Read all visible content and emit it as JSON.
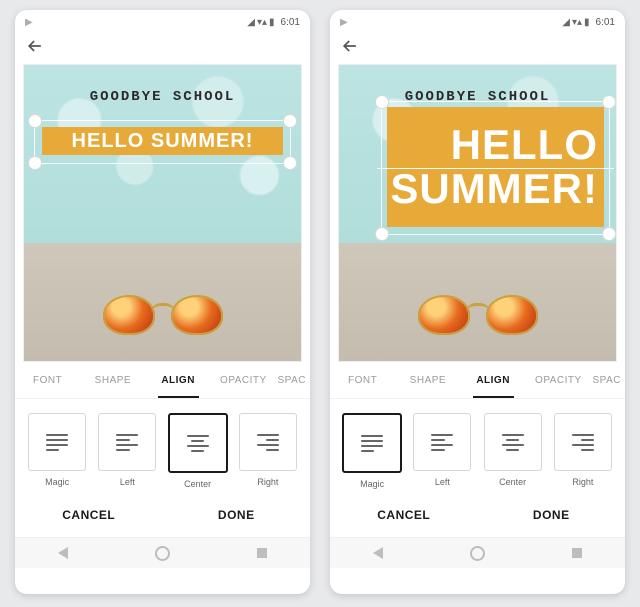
{
  "status": {
    "time": "6:01"
  },
  "canvas": {
    "line1": "GOODBYE SCHOOL",
    "hello_single": "HELLO SUMMER!",
    "hello_a": "HELLO",
    "hello_b": "SUMMER!"
  },
  "tabs": {
    "font": "FONT",
    "shape": "SHAPE",
    "align": "ALIGN",
    "opacity": "OPACITY",
    "spac": "SPAC"
  },
  "align": {
    "magic": "Magic",
    "left": "Left",
    "center": "Center",
    "right": "Right"
  },
  "actions": {
    "cancel": "CANCEL",
    "done": "DONE"
  },
  "screens": {
    "left": {
      "selected": "center"
    },
    "right": {
      "selected": "magic"
    }
  }
}
